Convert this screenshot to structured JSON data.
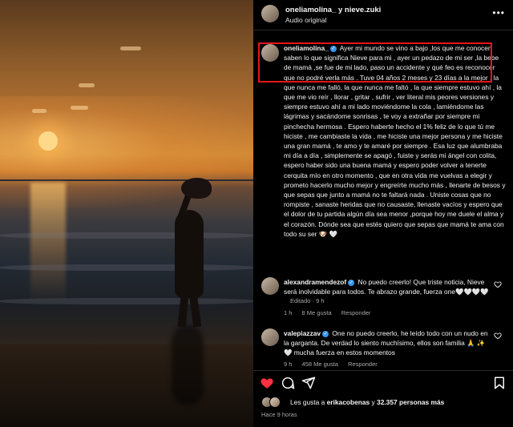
{
  "header": {
    "title": "oneliamolina_ y nieve.zuki",
    "subtitle": "Audio original",
    "more_icon": "more-horizontal-icon"
  },
  "caption": {
    "username": "oneliamolina_",
    "text": "Ayer mi mundo se vino a bajo ,los que me conocen saben lo que significa Nieve para mi , ayer un pedazo de mi ser ,la bebe de mamá ,se fue de mi lado, paso un accidente y qué feo es reconocer que no podré verla más . Tuve 04 años 2 meses y 23 días a la mejor , la que nunca me falló, la que nunca me faltó , la que siempre estuvo ahí , la que me vio reír , llorar , gritar , sufrir , ver literal mis peores versiones y siempre estuvo ahí a mi lado moviéndome la cola , lamiéndome las lágrimas y sacándome sonrisas , te voy a extrañar por siempre mi pinchecha hermosa . Espero haberte hecho el 1% feliz de lo que tú me hiciste , me cambiaste la vida , me hiciste una mejor persona y me hiciste una gran mamá , te amo y te amaré por siempre . Esa luz que alumbraba mi día a día , simplemente se apagó , fuiste y serás mi ángel con colita, espero haber sido una buena mamá y espero poder volver a tenerte cerquita mío en otro momento , que en otra vida me vuelvas a elegir y prometo hacerlo mucho mejor y engreírte mucho más , llenarte de besos y que sepas que junto a mamá no te faltará nada . Uniste cosas que no rompiste , sanaste heridas que no causaste, llenaste vacíos y espero que el dolor de tu partida algún día sea menor ,porque hoy me duele el alma y el corazón. Dónde sea que estés quiero que sepas que mamá te ama con todo su ser 🐶 🤍",
    "edited": "Editado · 9 h"
  },
  "comments": [
    {
      "username": "alexandramendezof",
      "text": "No puedo creerlo! Que triste noticia, Nieve será inolvidable para todos. Te abrazo grande, fuerza one🤍🤍🤍🤍",
      "time": "1 h",
      "likes": "8 Me gusta",
      "reply": "Responder"
    },
    {
      "username": "valepiazzav",
      "text": "One no puedo creerlo, he leído todo con un nudo en la garganta. De verdad lo siento muchísimo, ellos son familia 🙏 ✨ 🤍 mucha fuerza en estos momentos",
      "time": "9 h",
      "likes": "458 Me gusta",
      "reply": "Responder"
    }
  ],
  "actions": {
    "like_icon": "heart-filled-icon",
    "comment_icon": "comment-icon",
    "share_icon": "send-icon",
    "save_icon": "bookmark-icon",
    "like_color": "#ff3040"
  },
  "likes": {
    "prefix": "Les gusta a ",
    "user": "erikacobenas",
    "middle": " y ",
    "count": "32.357 personas más"
  },
  "time": "Hace 9 horas",
  "colors": {
    "verified": "#3897f0",
    "highlight_box": "#e8141b",
    "muted_text": "#a8a8a8"
  }
}
